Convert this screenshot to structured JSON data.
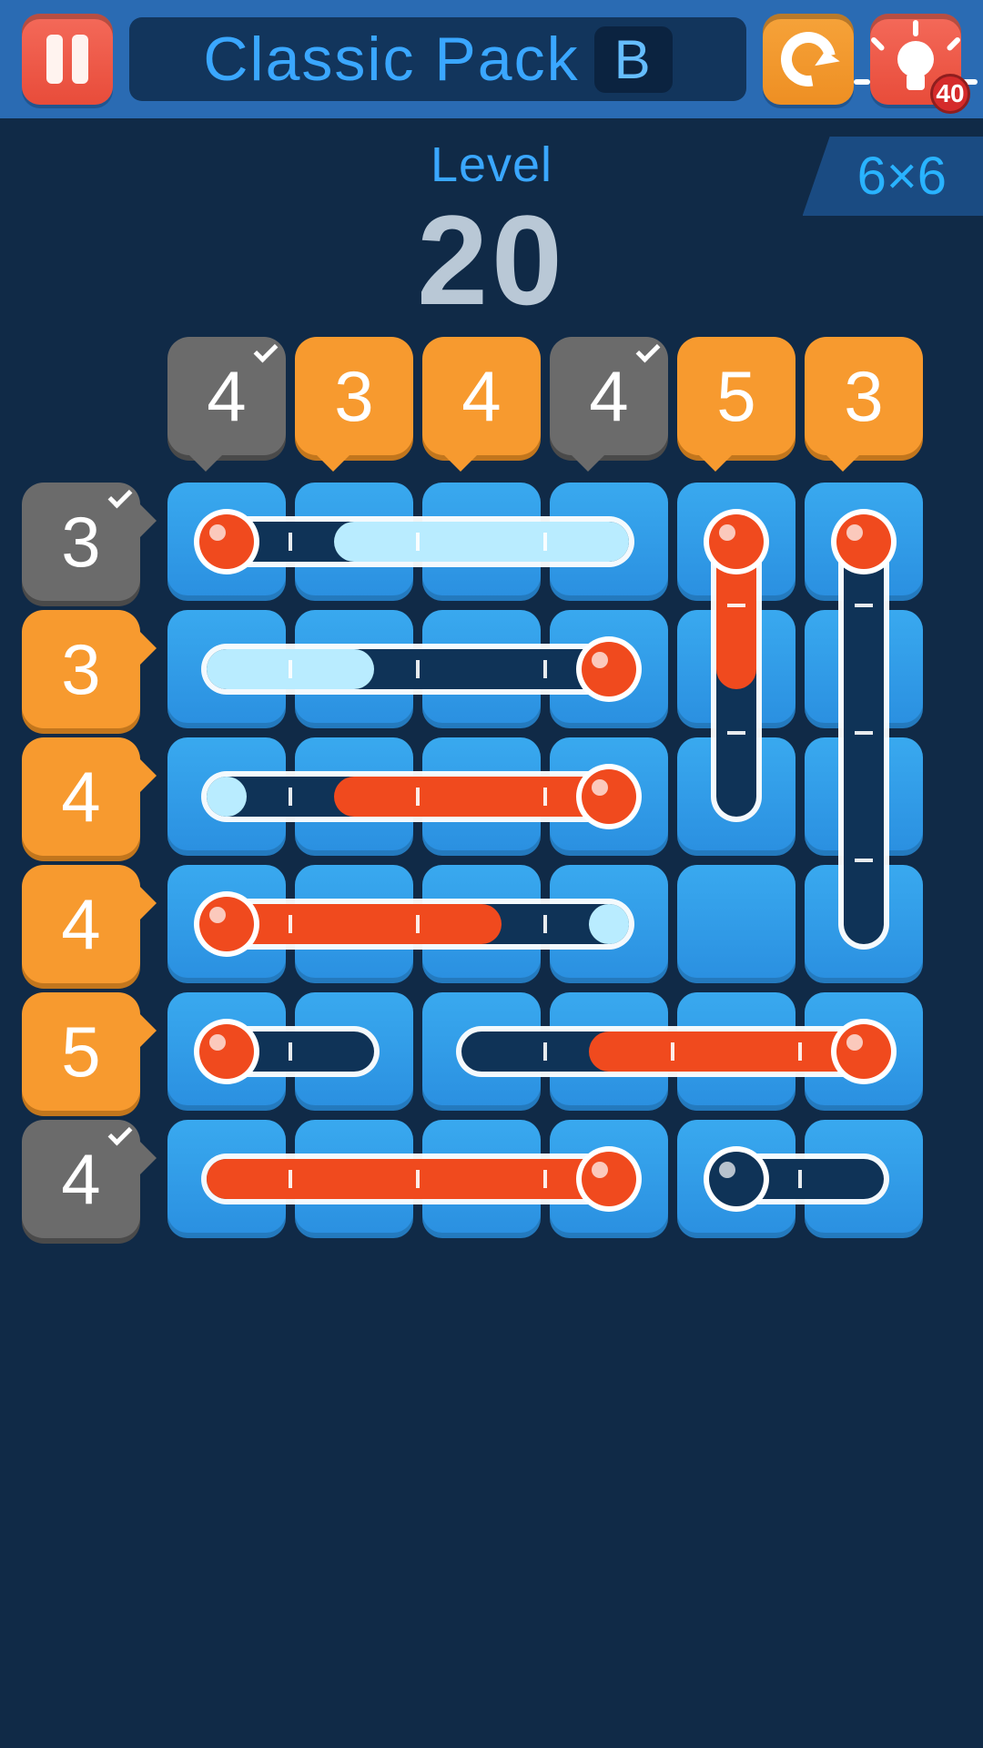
{
  "header": {
    "pack_name": "Classic Pack",
    "pack_letter": "B",
    "hint_count": 40
  },
  "level": {
    "label": "Level",
    "number": "20",
    "grid_size": "6×6"
  },
  "colors": {
    "accent_blue": "#3aa7ff",
    "tile_blue": "#2a8fe0",
    "hint_orange": "#f79a2f",
    "hint_gray": "#6b6b6b",
    "mercury_red": "#f04a1e",
    "mercury_cold": "#b9ecff",
    "tube_dark": "#0f3357"
  },
  "grid": {
    "cols": 6,
    "rows": 6
  },
  "col_hints": [
    {
      "value": 4,
      "satisfied": true
    },
    {
      "value": 3,
      "satisfied": false
    },
    {
      "value": 4,
      "satisfied": false
    },
    {
      "value": 4,
      "satisfied": true
    },
    {
      "value": 5,
      "satisfied": false
    },
    {
      "value": 3,
      "satisfied": false
    }
  ],
  "row_hints": [
    {
      "value": 3,
      "satisfied": true
    },
    {
      "value": 3,
      "satisfied": false
    },
    {
      "value": 4,
      "satisfied": false
    },
    {
      "value": 4,
      "satisfied": false
    },
    {
      "value": 5,
      "satisfied": false
    },
    {
      "value": 4,
      "satisfied": true
    }
  ],
  "thermometers": [
    {
      "bulb": [
        0,
        0
      ],
      "dir": "R",
      "len": 4,
      "segments": [
        "hot",
        "cold",
        "cold",
        "cold"
      ]
    },
    {
      "bulb": [
        4,
        0
      ],
      "dir": "D",
      "len": 3,
      "segments": [
        "hot",
        "hot",
        "empty"
      ]
    },
    {
      "bulb": [
        5,
        0
      ],
      "dir": "D",
      "len": 4,
      "segments": [
        "hot",
        "empty",
        "empty",
        "empty"
      ]
    },
    {
      "bulb": [
        3,
        1
      ],
      "dir": "L",
      "len": 4,
      "segments": [
        "hot",
        "empty",
        "cold",
        "cold"
      ]
    },
    {
      "bulb": [
        3,
        2
      ],
      "dir": "L",
      "len": 4,
      "segments": [
        "hot",
        "hot",
        "hot",
        "cold"
      ]
    },
    {
      "bulb": [
        0,
        3
      ],
      "dir": "R",
      "len": 4,
      "segments": [
        "hot",
        "hot",
        "hot",
        "cold"
      ]
    },
    {
      "bulb": [
        0,
        4
      ],
      "dir": "R",
      "len": 2,
      "segments": [
        "hot",
        "empty"
      ]
    },
    {
      "bulb": [
        5,
        4
      ],
      "dir": "L",
      "len": 4,
      "segments": [
        "hot",
        "hot",
        "hot",
        "empty"
      ]
    },
    {
      "bulb": [
        3,
        5
      ],
      "dir": "L",
      "len": 4,
      "segments": [
        "hot",
        "hot",
        "hot",
        "hot"
      ]
    },
    {
      "bulb": [
        4,
        5
      ],
      "dir": "R",
      "len": 2,
      "segments": [
        "empty",
        "empty"
      ]
    }
  ]
}
